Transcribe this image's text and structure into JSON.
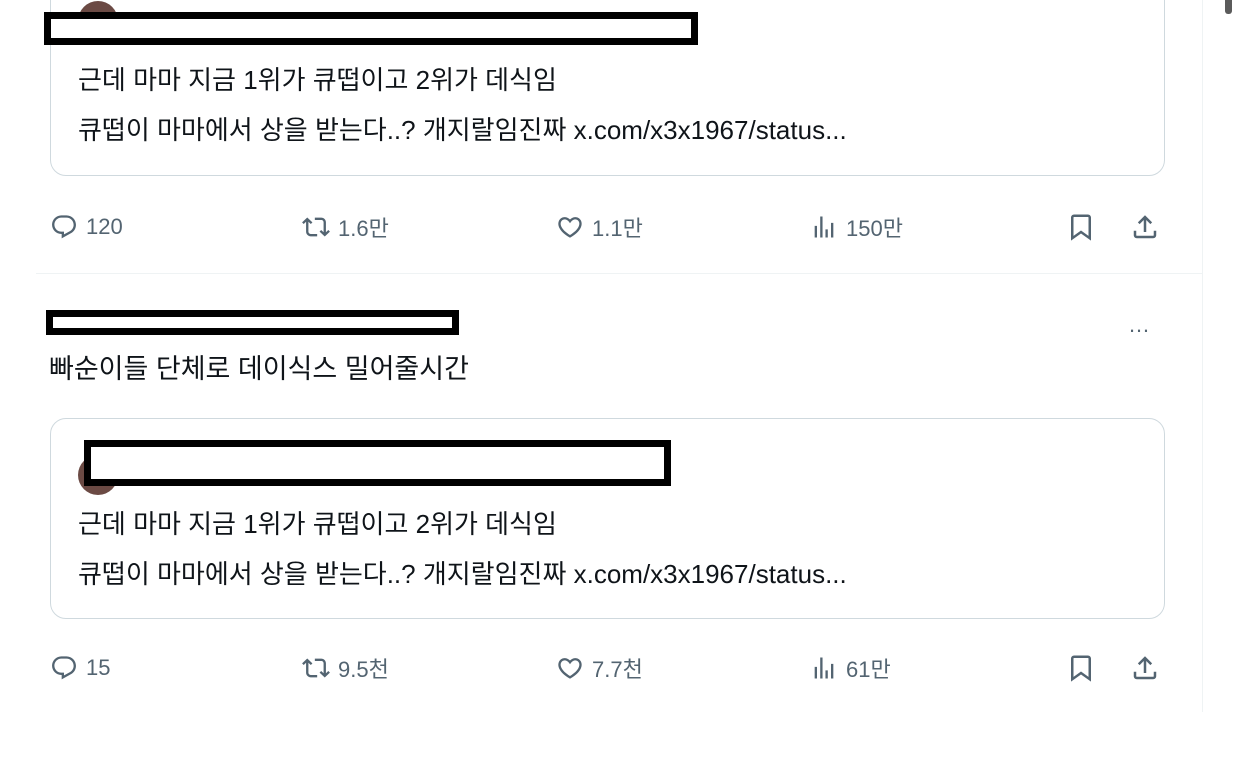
{
  "posts": [
    {
      "text": "",
      "quote": {
        "line1": "근데 마마 지금 1위가 큐떱이고 2위가 데식임",
        "line2": "큐떱이 마마에서 상을 받는다..? 개지랄임진짜",
        "link": "x.com/x3x1967/status..."
      },
      "stats": {
        "replies": "120",
        "reposts": "1.6만",
        "likes": "1.1만",
        "views": "150만"
      }
    },
    {
      "text": "빠순이들 단체로 데이식스 밀어줄시간",
      "more": "…",
      "quote": {
        "line1": "근데 마마 지금 1위가 큐떱이고 2위가 데식임",
        "line2": "큐떱이 마마에서 상을 받는다..? 개지랄임진짜",
        "link": "x.com/x3x1967/status..."
      },
      "stats": {
        "replies": "15",
        "reposts": "9.5천",
        "likes": "7.7천",
        "views": "61만"
      }
    }
  ],
  "icons": [
    "reply-icon",
    "repost-icon",
    "like-icon",
    "views-icon",
    "bookmark-icon",
    "share-icon"
  ],
  "colors": {
    "text": "#0f1419",
    "muted": "#536471",
    "border": "#cfd9de",
    "redaction": "#000000"
  }
}
